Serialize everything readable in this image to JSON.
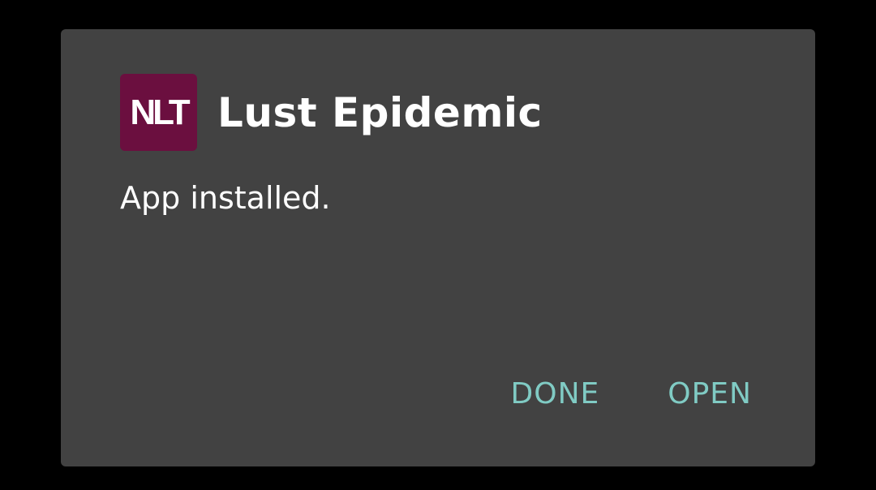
{
  "dialog": {
    "app_icon_text": "NLT",
    "app_title": "Lust Epidemic",
    "message": "App installed.",
    "buttons": {
      "done_label": "DONE",
      "open_label": "OPEN"
    }
  },
  "colors": {
    "background": "#000000",
    "dialog_surface": "#424242",
    "app_icon_bg": "#6b0f3f",
    "accent": "#80cbc4",
    "text": "#ffffff"
  }
}
